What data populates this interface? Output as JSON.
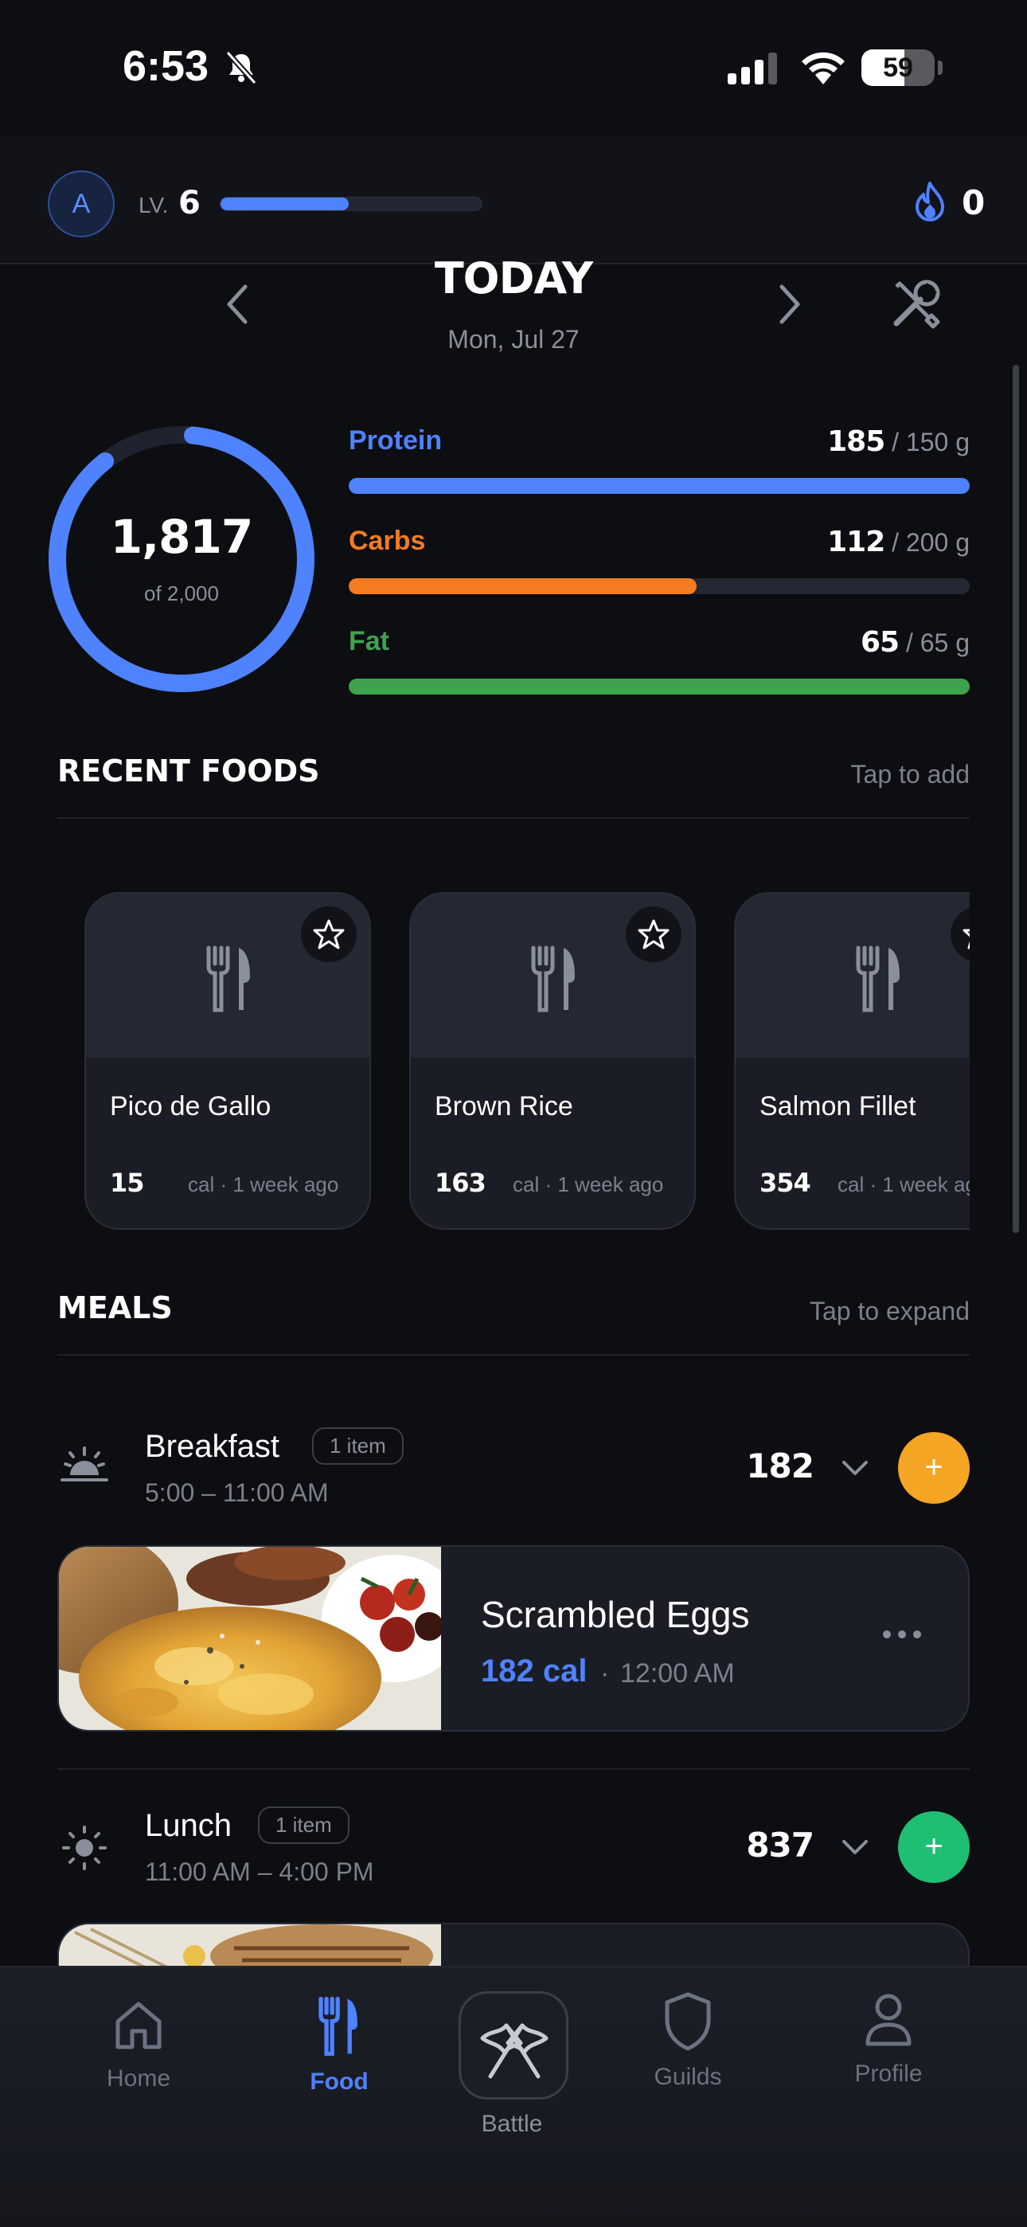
{
  "status_bar": {
    "time": "6:53",
    "battery": "59",
    "battery_level": 0.59
  },
  "header": {
    "avatar_initial": "A",
    "level_label": "LV.",
    "level": "6",
    "xp_progress": 0.49,
    "streak": "0"
  },
  "date_nav": {
    "title": "TODAY",
    "date": "Mon, Jul 27"
  },
  "calories": {
    "consumed": "1,817",
    "goal_text": "of 2,000",
    "progress": 0.9085
  },
  "macros": [
    {
      "name": "Protein",
      "current": "185",
      "goal": "/ 150 g",
      "progress": 1.0,
      "color": "#4f82ff"
    },
    {
      "name": "Carbs",
      "current": "112",
      "goal": "/ 200 g",
      "progress": 0.56,
      "color": "#f47b20"
    },
    {
      "name": "Fat",
      "current": "65",
      "goal": "/ 65 g",
      "progress": 1.0,
      "color": "#3fa34d"
    }
  ],
  "recent_foods": {
    "title": "RECENT FOODS",
    "hint": "Tap to add",
    "items": [
      {
        "name": "Pico de Gallo",
        "cal": "15",
        "meta": "cal · 1 week ago"
      },
      {
        "name": "Brown Rice",
        "cal": "163",
        "meta": "cal · 1 week ago"
      },
      {
        "name": "Salmon Fillet",
        "cal": "354",
        "meta": "cal · 1 week ago"
      }
    ]
  },
  "meals": {
    "title": "MEALS",
    "hint": "Tap to expand",
    "list": [
      {
        "name": "Breakfast",
        "count": "1 item",
        "time": "5:00 – 11:00 AM",
        "calories": "182",
        "add_color": "#f5a524",
        "entry": {
          "name": "Scrambled Eggs",
          "cal": "182 cal",
          "time": "12:00 AM"
        }
      },
      {
        "name": "Lunch",
        "count": "1 item",
        "time": "11:00 AM – 4:00 PM",
        "calories": "837",
        "add_color": "#1fbf73"
      }
    ]
  },
  "tabbar": {
    "items": [
      {
        "label": "Home",
        "icon": "home-icon"
      },
      {
        "label": "Food",
        "icon": "fork-knife-icon",
        "active": true
      },
      {
        "label": "Battle",
        "icon": "crossed-flags-icon"
      },
      {
        "label": "Guilds",
        "icon": "shield-icon"
      },
      {
        "label": "Profile",
        "icon": "person-icon"
      }
    ]
  },
  "colors": {
    "accent": "#4f82ff",
    "background": "#0d0e12",
    "card": "#1a1d25"
  }
}
